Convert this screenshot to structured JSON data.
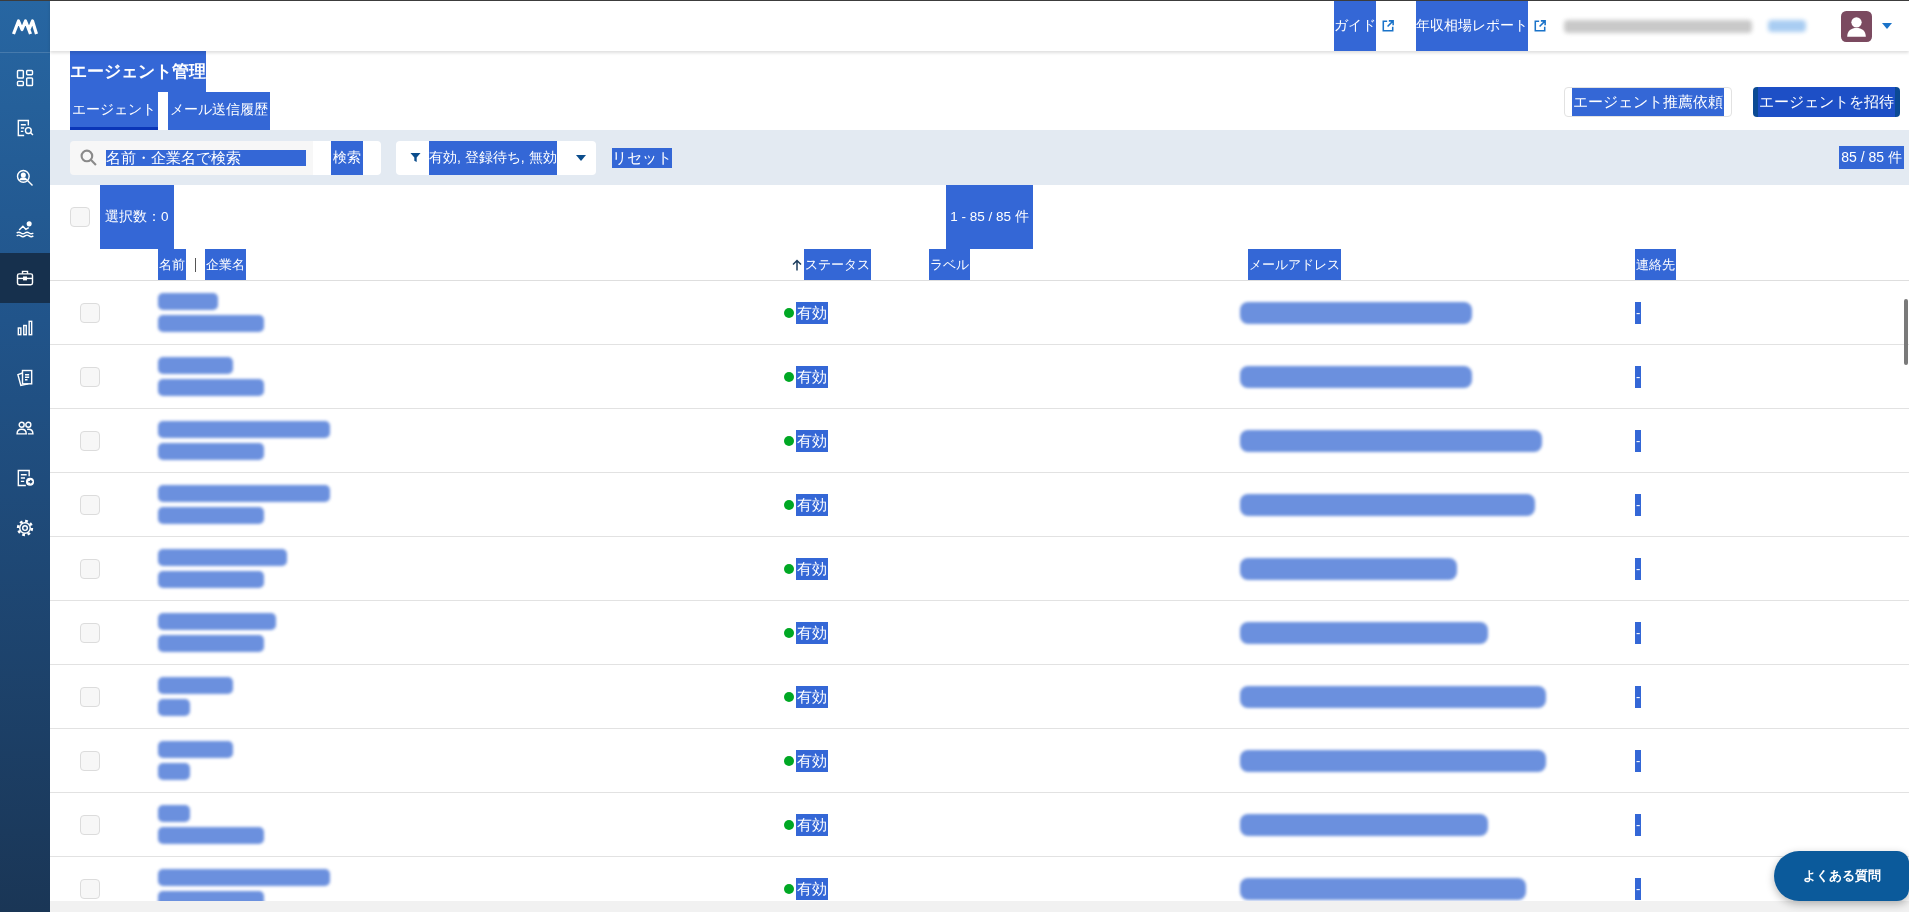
{
  "sidebar": {
    "items": [
      {
        "kind": "grid",
        "selected": false
      },
      {
        "kind": "document-search",
        "selected": false
      },
      {
        "kind": "person-search",
        "selected": false
      },
      {
        "kind": "swimmer",
        "selected": false
      },
      {
        "kind": "briefcase",
        "selected": true
      },
      {
        "kind": "bar-chart",
        "selected": false
      },
      {
        "kind": "documents",
        "selected": false
      },
      {
        "kind": "people",
        "selected": false
      },
      {
        "kind": "document-export",
        "selected": false
      },
      {
        "kind": "settings",
        "selected": false
      }
    ]
  },
  "header": {
    "links": [
      {
        "label": "ガイド"
      },
      {
        "label": "年収相場レポート"
      }
    ]
  },
  "page": {
    "title": "エージェント管理",
    "tabs": [
      {
        "label": "エージェント",
        "selected": true
      },
      {
        "label": "メール送信履歴",
        "selected": false
      }
    ],
    "actions": [
      {
        "label": "エージェント推薦依頼",
        "kind": "outline"
      },
      {
        "label": "エージェントを招待",
        "kind": "primary"
      }
    ]
  },
  "filter_bar": {
    "search": {
      "placeholder": "名前・企業名で検索",
      "button": "検索"
    },
    "status_filter": {
      "value": "有効, 登録待ち, 無効"
    },
    "reset": "リセット",
    "total": "85 / 85 件"
  },
  "selection": {
    "checked": false,
    "count": "選択数：0"
  },
  "pagination": "1 - 85 / 85 件",
  "table": {
    "columns": [
      {
        "headers": [
          {
            "label": "名前",
            "sorted": false
          },
          {
            "label": "企業名",
            "sorted": false
          }
        ]
      },
      {
        "headers": [
          {
            "label": "ステータス",
            "sorted": true
          }
        ]
      },
      {
        "headers": [
          {
            "label": "ラベル",
            "sorted": false
          }
        ]
      },
      {
        "headers": [
          {
            "label": "メールアドレス",
            "sorted": false
          }
        ]
      },
      {
        "headers": [
          {
            "label": "連絡先",
            "sorted": false
          }
        ]
      }
    ],
    "rows": [
      {
        "checked": false,
        "status": {
          "label": "有効",
          "color": "#00a824"
        },
        "contact": "-"
      },
      {
        "checked": false,
        "status": {
          "label": "有効",
          "color": "#00a824"
        },
        "contact": "-"
      },
      {
        "checked": false,
        "status": {
          "label": "有効",
          "color": "#00a824"
        },
        "contact": "-"
      },
      {
        "checked": false,
        "status": {
          "label": "有効",
          "color": "#00a824"
        },
        "contact": "-"
      },
      {
        "checked": false,
        "status": {
          "label": "有効",
          "color": "#00a824"
        },
        "contact": "-"
      },
      {
        "checked": false,
        "status": {
          "label": "有効",
          "color": "#00a824"
        },
        "contact": "-"
      },
      {
        "checked": false,
        "status": {
          "label": "有効",
          "color": "#00a824"
        },
        "contact": "-"
      },
      {
        "checked": false,
        "status": {
          "label": "有効",
          "color": "#00a824"
        },
        "contact": "-"
      },
      {
        "checked": false,
        "status": {
          "label": "有効",
          "color": "#00a824"
        },
        "contact": "-"
      },
      {
        "checked": false,
        "status": {
          "label": "有効",
          "color": "#00a824"
        },
        "contact": "-"
      }
    ]
  },
  "help_button": {
    "label": "よくある質問"
  }
}
